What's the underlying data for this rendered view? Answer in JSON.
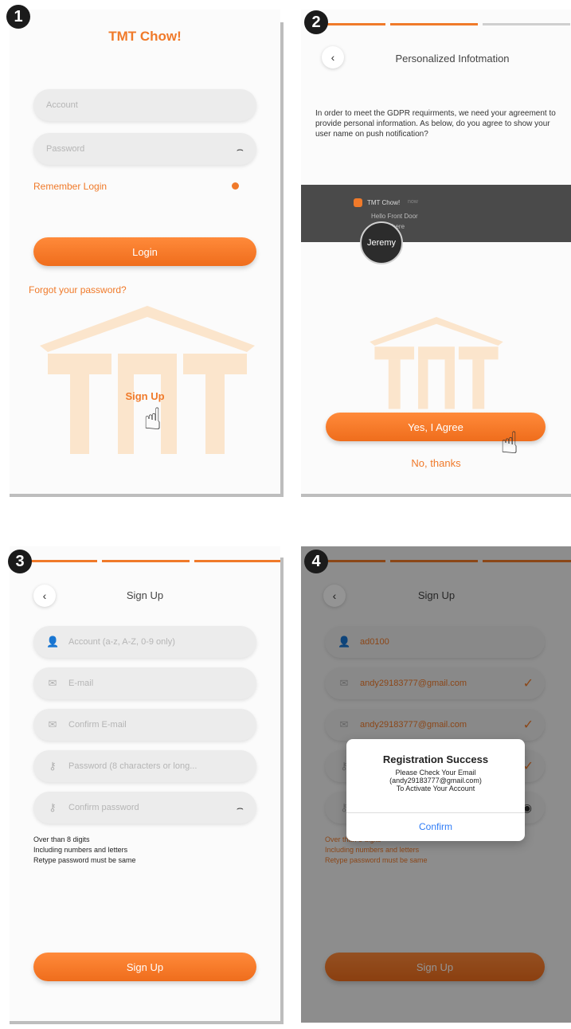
{
  "steps": [
    "1",
    "2",
    "3",
    "4"
  ],
  "login": {
    "app_title": "TMT Chow!",
    "account_placeholder": "Account",
    "password_placeholder": "Password",
    "remember_login": "Remember Login",
    "login_button": "Login",
    "forgot_password": "Forgot your password?",
    "sign_up": "Sign Up"
  },
  "consent": {
    "header_title": "Personalized Infotmation",
    "body_text": "In order to meet the GDPR requirments, we need your agreement to provide personal information. As below, do you agree to show your user name on push notification?",
    "notif_app": "TMT Chow!",
    "notif_time": "now",
    "notif_line1": "Hello Front Door",
    "notif_line2": "is here",
    "user_name": "Jeremy",
    "agree_button": "Yes, I Agree",
    "decline_button": "No, thanks"
  },
  "signup": {
    "header_title": "Sign Up",
    "account_placeholder": "Account (a-z, A-Z, 0-9 only)",
    "email_placeholder": "E-mail",
    "confirm_email_placeholder": "Confirm E-mail",
    "password_placeholder": "Password (8 characters or long...",
    "confirm_password_placeholder": "Confirm password",
    "rules": [
      "Over than 8 digits",
      "Including numbers and letters",
      "Retype password must be same"
    ],
    "sign_up_button": "Sign Up"
  },
  "signup_filled": {
    "header_title": "Sign Up",
    "account_value": "ad0100",
    "email_value": "andy29183777@gmail.com",
    "confirm_email_value": "andy29183777@gmail.com",
    "rules": [
      "Over than 8 digits",
      "Including numbers and letters",
      "Retype password must be same"
    ],
    "sign_up_button": "Sign Up",
    "dialog": {
      "title": "Registration Success",
      "line1": "Please Check Your Email",
      "line2": "(andy29183777@gmail.com)",
      "line3": "To Activate Your Account",
      "confirm": "Confirm"
    }
  },
  "colors": {
    "accent": "#f07a2a",
    "dark": "#1b1b1b",
    "field_bg": "#ececec"
  },
  "icons": {
    "back": "chevron-left-icon",
    "eye": "eye-icon",
    "user": "user-icon",
    "mail": "mail-icon",
    "key": "key-icon",
    "check": "check-icon",
    "hand": "pointing-hand-icon"
  }
}
